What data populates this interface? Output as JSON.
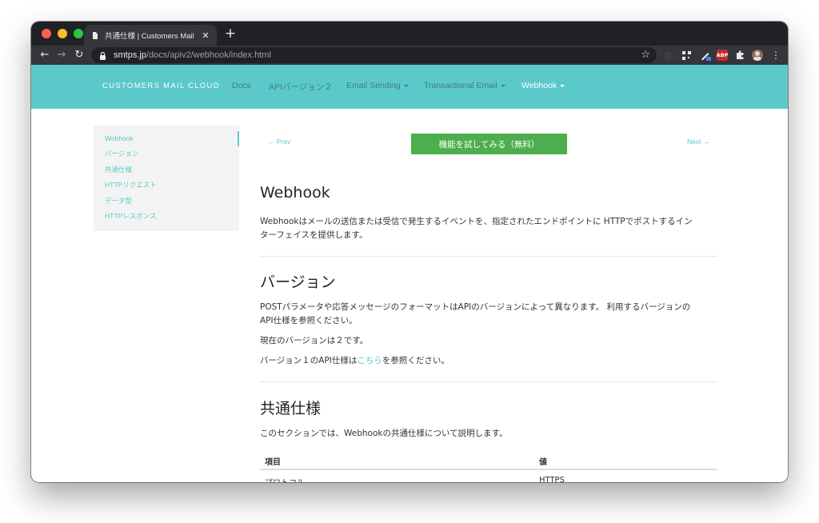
{
  "browser": {
    "tab_title": "共通仕様 | Customers Mail Cloud",
    "url_domain": "smtps.jp",
    "url_path": "/docs/apiv2/webhook/index.html",
    "new_tab_label": "+",
    "tab_close_label": "✕",
    "ext_abp_label": "ABP"
  },
  "site_nav": {
    "brand": "CUSTOMERS MAIL CLOUD",
    "items": [
      {
        "label": "Docs"
      },
      {
        "label": "APIバージョン２"
      },
      {
        "label": "Email Sending"
      },
      {
        "label": "Transactional Email"
      },
      {
        "label": "Webhook"
      }
    ]
  },
  "sidebar": {
    "items": [
      {
        "label": "Webhook"
      },
      {
        "label": "バージョン"
      },
      {
        "label": "共通仕様"
      },
      {
        "label": "HTTPリクエスト"
      },
      {
        "label": "データ型"
      },
      {
        "label": "HTTPレスポンス"
      }
    ]
  },
  "pager": {
    "prev": "← Prev",
    "next": "Next →",
    "try_button": "機能を試してみる（無料）"
  },
  "content": {
    "section1_title": "Webhook",
    "section1_p1_line1": "Webhookはメールの送信または受信で発生するイベントを、指定されたエンドポイントに HTTPでポストするイン",
    "section1_p1_line2": "ターフェイスを提供します。",
    "section2_title": "バージョン",
    "section2_p1_line1": "POSTパラメータや応答メッセージのフォーマットはAPIのバージョンによって異なります。 利用するバージョンの",
    "section2_p1_line2": "API仕様を参照ください。",
    "section2_p2": "現在のバージョンは２です。",
    "section2_p3_before": "バージョン１のAPI仕様は",
    "section2_p3_link": "こちら",
    "section2_p3_after": "を参照ください。",
    "section3_title": "共通仕様",
    "section3_p1": "このセクションでは、Webhookの共通仕様について説明します。",
    "table": {
      "headers": [
        "項目",
        "値"
      ],
      "rows": [
        [
          "プロトコル",
          "HTTPS"
        ]
      ]
    }
  }
}
